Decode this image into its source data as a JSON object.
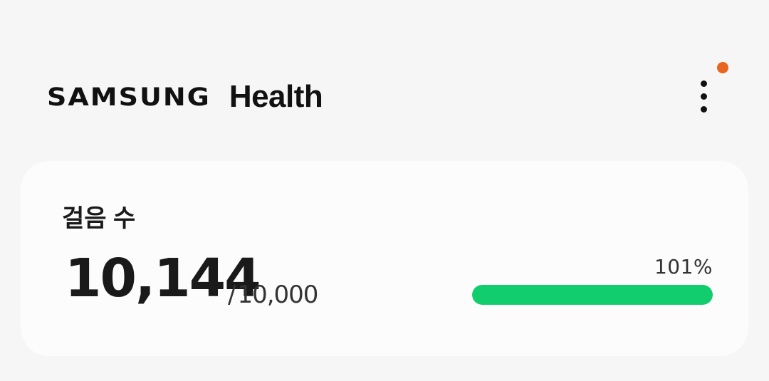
{
  "header": {
    "logo_brand": "SAMSUNG",
    "logo_product": "Health",
    "more_icon": "more-vertical-icon",
    "notification_color": "#e8661f"
  },
  "steps_card": {
    "title": "걸음 수",
    "steps": "10,144",
    "goal_separator": "/",
    "goal": "10,000",
    "percent_label": "101%",
    "progress_fraction": 1.0,
    "progress_color": "#11cd6d"
  }
}
